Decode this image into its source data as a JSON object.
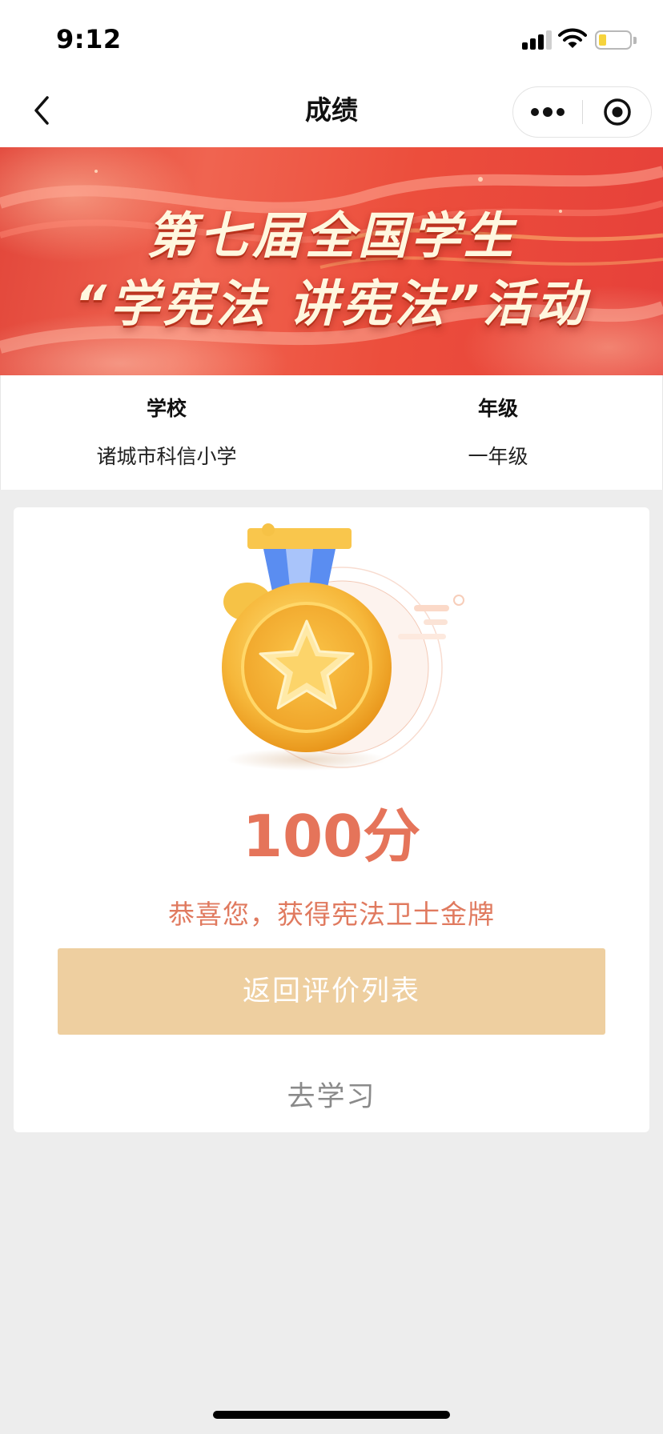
{
  "status_bar": {
    "time": "9:12",
    "signal_icon": "cellular-signal-icon",
    "wifi_icon": "wifi-icon",
    "battery_icon": "battery-low-icon",
    "battery_color": "#f6d33c"
  },
  "nav": {
    "title": "成绩",
    "back_icon": "chevron-left-icon",
    "more_icon": "more-dots-icon",
    "close_icon": "target-close-icon"
  },
  "banner": {
    "line1": "第七届全国学生",
    "line2": "“学宪法  讲宪法”活动"
  },
  "info": {
    "school_label": "学校",
    "school_value": "诸城市科信小学",
    "grade_label": "年级",
    "grade_value": "一年级"
  },
  "result": {
    "medal_icon": "gold-medal-star-icon",
    "score": "100分",
    "congrats": "恭喜您，获得宪法卫士金牌",
    "back_button": "返回评价列表",
    "study_link": "去学习",
    "score_color": "#e5745a",
    "button_color": "#eecfa0"
  }
}
